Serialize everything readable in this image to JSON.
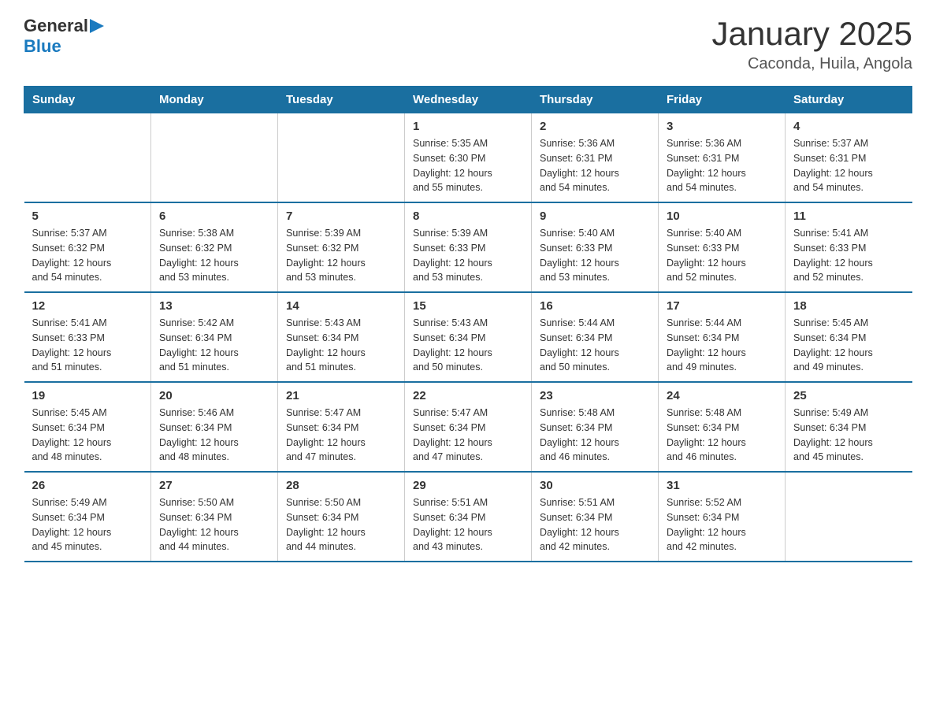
{
  "header": {
    "logo_general": "General",
    "logo_blue": "Blue",
    "title": "January 2025",
    "subtitle": "Caconda, Huila, Angola"
  },
  "days_of_week": [
    "Sunday",
    "Monday",
    "Tuesday",
    "Wednesday",
    "Thursday",
    "Friday",
    "Saturday"
  ],
  "weeks": [
    [
      {
        "day": "",
        "info": ""
      },
      {
        "day": "",
        "info": ""
      },
      {
        "day": "",
        "info": ""
      },
      {
        "day": "1",
        "info": "Sunrise: 5:35 AM\nSunset: 6:30 PM\nDaylight: 12 hours\nand 55 minutes."
      },
      {
        "day": "2",
        "info": "Sunrise: 5:36 AM\nSunset: 6:31 PM\nDaylight: 12 hours\nand 54 minutes."
      },
      {
        "day": "3",
        "info": "Sunrise: 5:36 AM\nSunset: 6:31 PM\nDaylight: 12 hours\nand 54 minutes."
      },
      {
        "day": "4",
        "info": "Sunrise: 5:37 AM\nSunset: 6:31 PM\nDaylight: 12 hours\nand 54 minutes."
      }
    ],
    [
      {
        "day": "5",
        "info": "Sunrise: 5:37 AM\nSunset: 6:32 PM\nDaylight: 12 hours\nand 54 minutes."
      },
      {
        "day": "6",
        "info": "Sunrise: 5:38 AM\nSunset: 6:32 PM\nDaylight: 12 hours\nand 53 minutes."
      },
      {
        "day": "7",
        "info": "Sunrise: 5:39 AM\nSunset: 6:32 PM\nDaylight: 12 hours\nand 53 minutes."
      },
      {
        "day": "8",
        "info": "Sunrise: 5:39 AM\nSunset: 6:33 PM\nDaylight: 12 hours\nand 53 minutes."
      },
      {
        "day": "9",
        "info": "Sunrise: 5:40 AM\nSunset: 6:33 PM\nDaylight: 12 hours\nand 53 minutes."
      },
      {
        "day": "10",
        "info": "Sunrise: 5:40 AM\nSunset: 6:33 PM\nDaylight: 12 hours\nand 52 minutes."
      },
      {
        "day": "11",
        "info": "Sunrise: 5:41 AM\nSunset: 6:33 PM\nDaylight: 12 hours\nand 52 minutes."
      }
    ],
    [
      {
        "day": "12",
        "info": "Sunrise: 5:41 AM\nSunset: 6:33 PM\nDaylight: 12 hours\nand 51 minutes."
      },
      {
        "day": "13",
        "info": "Sunrise: 5:42 AM\nSunset: 6:34 PM\nDaylight: 12 hours\nand 51 minutes."
      },
      {
        "day": "14",
        "info": "Sunrise: 5:43 AM\nSunset: 6:34 PM\nDaylight: 12 hours\nand 51 minutes."
      },
      {
        "day": "15",
        "info": "Sunrise: 5:43 AM\nSunset: 6:34 PM\nDaylight: 12 hours\nand 50 minutes."
      },
      {
        "day": "16",
        "info": "Sunrise: 5:44 AM\nSunset: 6:34 PM\nDaylight: 12 hours\nand 50 minutes."
      },
      {
        "day": "17",
        "info": "Sunrise: 5:44 AM\nSunset: 6:34 PM\nDaylight: 12 hours\nand 49 minutes."
      },
      {
        "day": "18",
        "info": "Sunrise: 5:45 AM\nSunset: 6:34 PM\nDaylight: 12 hours\nand 49 minutes."
      }
    ],
    [
      {
        "day": "19",
        "info": "Sunrise: 5:45 AM\nSunset: 6:34 PM\nDaylight: 12 hours\nand 48 minutes."
      },
      {
        "day": "20",
        "info": "Sunrise: 5:46 AM\nSunset: 6:34 PM\nDaylight: 12 hours\nand 48 minutes."
      },
      {
        "day": "21",
        "info": "Sunrise: 5:47 AM\nSunset: 6:34 PM\nDaylight: 12 hours\nand 47 minutes."
      },
      {
        "day": "22",
        "info": "Sunrise: 5:47 AM\nSunset: 6:34 PM\nDaylight: 12 hours\nand 47 minutes."
      },
      {
        "day": "23",
        "info": "Sunrise: 5:48 AM\nSunset: 6:34 PM\nDaylight: 12 hours\nand 46 minutes."
      },
      {
        "day": "24",
        "info": "Sunrise: 5:48 AM\nSunset: 6:34 PM\nDaylight: 12 hours\nand 46 minutes."
      },
      {
        "day": "25",
        "info": "Sunrise: 5:49 AM\nSunset: 6:34 PM\nDaylight: 12 hours\nand 45 minutes."
      }
    ],
    [
      {
        "day": "26",
        "info": "Sunrise: 5:49 AM\nSunset: 6:34 PM\nDaylight: 12 hours\nand 45 minutes."
      },
      {
        "day": "27",
        "info": "Sunrise: 5:50 AM\nSunset: 6:34 PM\nDaylight: 12 hours\nand 44 minutes."
      },
      {
        "day": "28",
        "info": "Sunrise: 5:50 AM\nSunset: 6:34 PM\nDaylight: 12 hours\nand 44 minutes."
      },
      {
        "day": "29",
        "info": "Sunrise: 5:51 AM\nSunset: 6:34 PM\nDaylight: 12 hours\nand 43 minutes."
      },
      {
        "day": "30",
        "info": "Sunrise: 5:51 AM\nSunset: 6:34 PM\nDaylight: 12 hours\nand 42 minutes."
      },
      {
        "day": "31",
        "info": "Sunrise: 5:52 AM\nSunset: 6:34 PM\nDaylight: 12 hours\nand 42 minutes."
      },
      {
        "day": "",
        "info": ""
      }
    ]
  ]
}
